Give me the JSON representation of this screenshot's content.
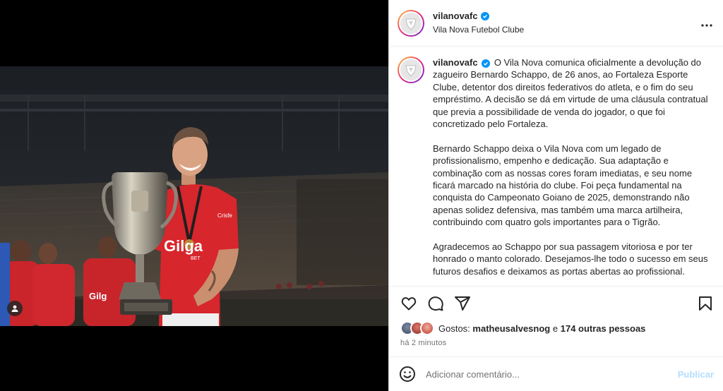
{
  "post": {
    "username": "vilanovafc",
    "verified": true,
    "subtitle": "Vila Nova Futebol Clube",
    "more_icon": "more-horizontal-icon",
    "caption_paragraphs": [
      "O Vila Nova comunica oficialmente a devolução do zagueiro Bernardo Schappo, de 26 anos, ao Fortaleza Esporte Clube, detentor dos direitos federativos do atleta, e o fim do seu empréstimo. A decisão se dá em virtude de uma cláusula contratual que previa a possibilidade de venda do jogador, o que foi concretizado pelo Fortaleza.",
      "Bernardo Schappo deixa o Vila Nova com um legado de profissionalismo, empenho e dedicação. Sua adaptação e combinação com as nossas cores foram imediatas, e seu nome ficará marcado na história do clube. Foi peça fundamental na conquista do Campeonato Goiano de 2025, demonstrando não apenas solidez defensiva, mas também uma marca artilheira, contribuindo com quatro gols importantes para o Tigrão.",
      "Agradecemos ao Schappo por sua passagem vitoriosa e por ter honrado o manto colorado. Desejamos-lhe todo o sucesso em seus futuros desafios e deixamos as portas abertas ao profissional."
    ]
  },
  "photo": {
    "jersey_sponsor": "Gilga",
    "jersey_sponsor_sub": "BET",
    "sleeve_text": "Crisfe"
  },
  "likes": {
    "prefix": "Gostos:",
    "first_user": "matheusalvesnog",
    "joiner": "e",
    "others": "174 outras pessoas"
  },
  "timestamp": "há 2 minutos",
  "comment": {
    "placeholder": "Adicionar comentário...",
    "publish_label": "Publicar"
  },
  "colors": {
    "accent_blue": "#0095f6",
    "publish_disabled": "#b2dffc",
    "jersey_red": "#d7262c"
  }
}
